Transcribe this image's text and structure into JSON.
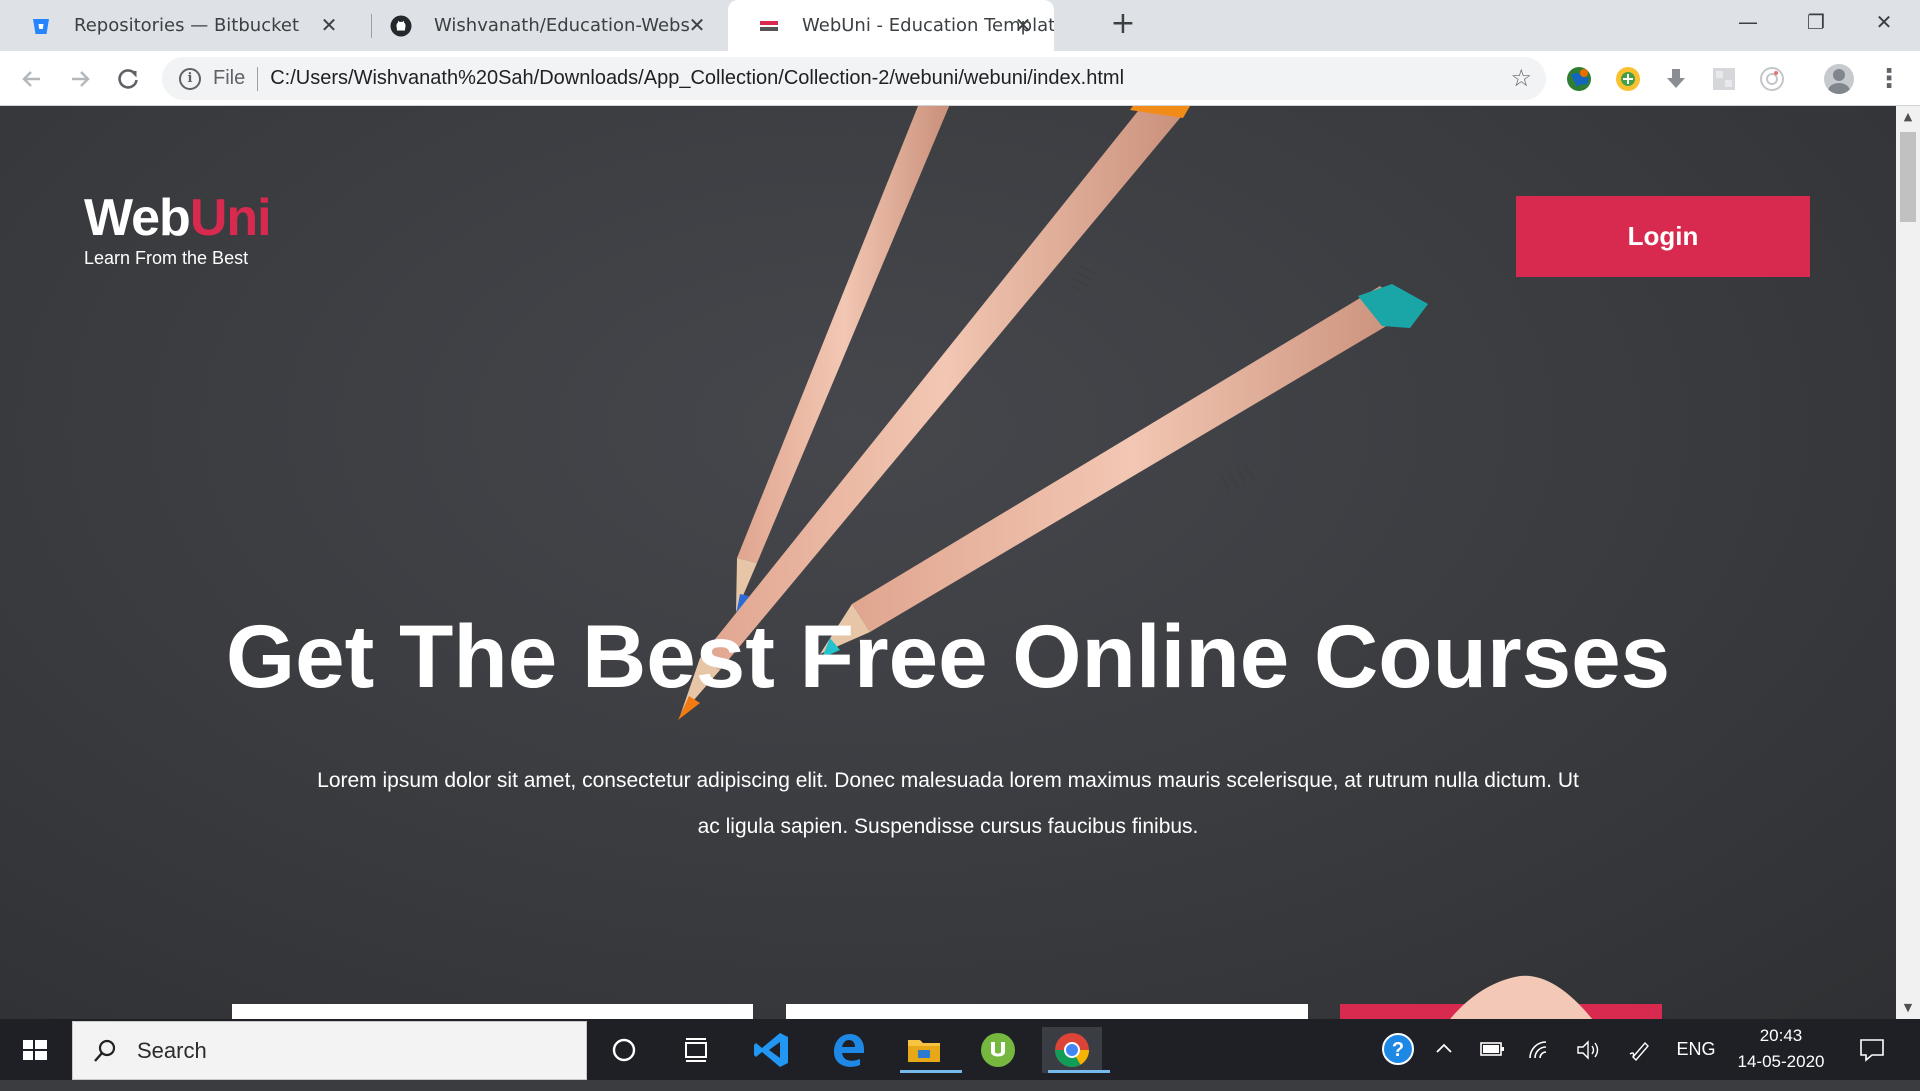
{
  "browser": {
    "tabs": [
      {
        "title": "Repositories — Bitbucket",
        "icon": "bitbucket-icon",
        "active": false
      },
      {
        "title": "Wishvanath/Education-Website-T",
        "icon": "github-icon",
        "active": false
      },
      {
        "title": "WebUni - Education Template",
        "icon": "webuni-favicon",
        "active": true
      }
    ],
    "new_tab": "+",
    "window_controls": {
      "minimize": "—",
      "restore": "❐",
      "close": "✕"
    },
    "address": {
      "scheme": "File",
      "url": "C:/Users/Wishvanath%20Sah/Downloads/App_Collection/Collection-2/webuni/webuni/index.html"
    }
  },
  "page": {
    "logo": {
      "web": "Web",
      "uni": "Uni",
      "tagline": "Learn From the Best"
    },
    "login_label": "Login",
    "hero": {
      "title": "Get The Best Free Online Courses",
      "text": "Lorem ipsum dolor sit amet, consectetur adipiscing elit. Donec malesuada lorem maximus mauris scelerisque, at rutrum nulla dictum. Ut ac ligula sapien. Suspendisse cursus faucibus finibus."
    },
    "colors": {
      "accent": "#d82a4e",
      "background": "#3a3c40"
    }
  },
  "taskbar": {
    "search_label": "Search",
    "apps": [
      "cortana-icon",
      "task-view-icon",
      "vscode-icon",
      "edge-icon",
      "file-explorer-icon",
      "utorrent-icon",
      "chrome-icon"
    ],
    "tray": {
      "language": "ENG",
      "time": "20:43",
      "date": "14-05-2020"
    }
  }
}
